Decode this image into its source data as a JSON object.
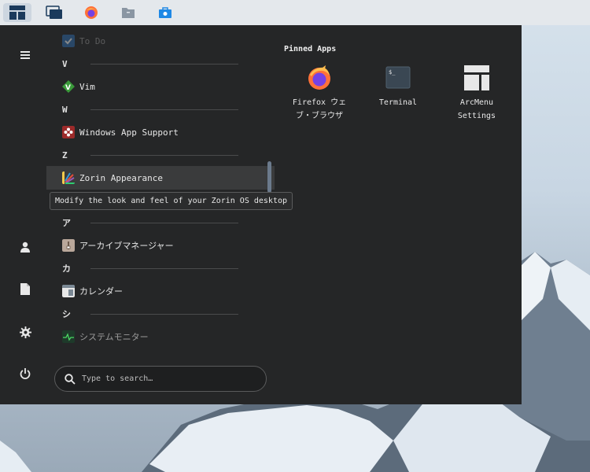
{
  "panel": {
    "buttons": [
      {
        "icon": "arcmenu-icon"
      },
      {
        "icon": "workspaces-icon"
      },
      {
        "icon": "firefox-icon"
      },
      {
        "icon": "files-icon"
      },
      {
        "icon": "software-store-icon"
      }
    ]
  },
  "menu": {
    "apps": [
      {
        "letter": "",
        "label": "To Do",
        "faded": true
      },
      {
        "letter": "V"
      },
      {
        "label": "Vim"
      },
      {
        "letter": "W"
      },
      {
        "label": "Windows App Support"
      },
      {
        "letter": "Z"
      },
      {
        "label": "Zorin Appearance"
      },
      {
        "letter": "ア"
      },
      {
        "label": "アーカイブマネージャー"
      },
      {
        "letter": "カ"
      },
      {
        "label": "カレンダー"
      },
      {
        "letter": "シ"
      },
      {
        "label": "システムモニター"
      }
    ],
    "labels": {
      "todo": "To Do",
      "v": "V",
      "vim": "Vim",
      "w": "W",
      "windows_app_support": "Windows App Support",
      "z": "Z",
      "zorin_appearance": "Zorin Appearance",
      "a_kana": "ア",
      "archive_manager": "アーカイブマネージャー",
      "ka_kana": "カ",
      "calendar": "カレンダー",
      "shi_kana": "シ",
      "system_monitor": "システムモニター"
    },
    "tooltip": "Modify the look and feel of your Zorin OS desktop",
    "search_placeholder": "Type to search…",
    "pinned": {
      "title": "Pinned Apps",
      "firefox_line1": "Firefox ウェ",
      "firefox_line2": "ブ・ブラウザ",
      "terminal": "Terminal",
      "arcmenu_line1": "ArcMenu",
      "arcmenu_line2": "Settings"
    }
  },
  "colors": {
    "menu_bg": "#252627",
    "panel_bg": "#e4e8ec",
    "accent": "#1e88e5"
  }
}
